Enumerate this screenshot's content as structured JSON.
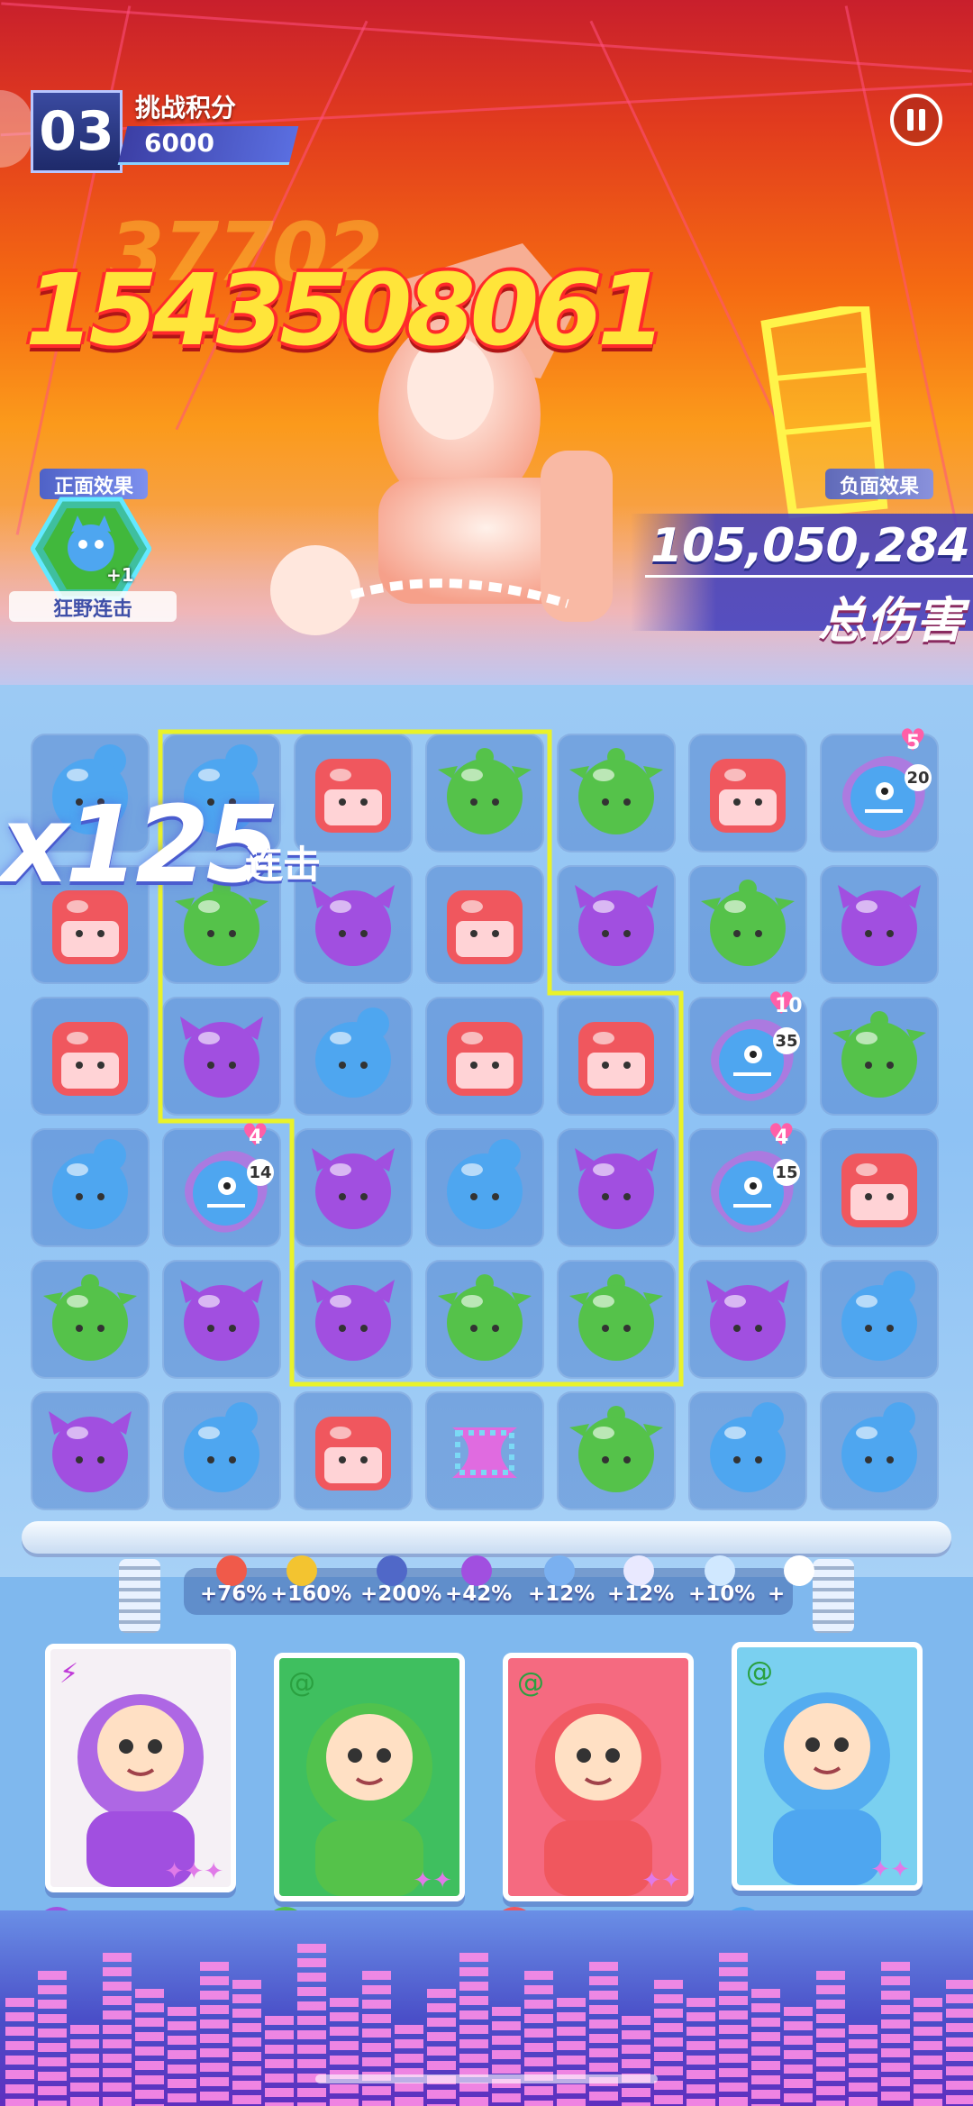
{
  "hud": {
    "stage_number": "03",
    "score_label": "挑战积分",
    "score_value": "6000",
    "pause_icon": "pause-icon"
  },
  "battle": {
    "damage_popup_ghost": "37702",
    "damage_popup": "1543508061",
    "positive_effect_label": "正面效果",
    "positive_effect_stack": "+1",
    "positive_effect_name": "狂野连击",
    "negative_effect_label": "负面效果",
    "total_damage_value": "105,050,284",
    "total_damage_label": "总伤害"
  },
  "board": {
    "combo_value": "x125",
    "combo_label": "连击",
    "colors": {
      "blue": "#4ea6f0",
      "red": "#f0575e",
      "green": "#55c24a",
      "purple": "#a14fe0"
    },
    "rows": [
      [
        "blue",
        "blue",
        "red",
        "green",
        "green",
        "red",
        "shark"
      ],
      [
        "red",
        "green",
        "purple",
        "red",
        "purple",
        "green",
        "purple"
      ],
      [
        "red",
        "purple",
        "blue",
        "red",
        "red",
        "shark",
        "green"
      ],
      [
        "blue",
        "shark",
        "purple",
        "blue",
        "purple",
        "shark",
        "red"
      ],
      [
        "green",
        "purple",
        "purple",
        "green",
        "green",
        "purple",
        "blue"
      ],
      [
        "purple",
        "blue",
        "red",
        "special",
        "green",
        "blue",
        "blue"
      ]
    ],
    "shark_badges": [
      {
        "row": 0,
        "col": 6,
        "hearts": "5",
        "turns": "20"
      },
      {
        "row": 2,
        "col": 5,
        "hearts": "10",
        "turns": "35"
      },
      {
        "row": 3,
        "col": 1,
        "hearts": "4",
        "turns": "14"
      },
      {
        "row": 3,
        "col": 5,
        "hearts": "4",
        "turns": "15"
      }
    ]
  },
  "buffs": [
    "+76%",
    "+160%",
    "+200%",
    "+42%",
    "+12%",
    "+12%",
    "+10%",
    "+"
  ],
  "heroes": [
    {
      "name": "skull-helmet-warrior",
      "color": "#a14fe0",
      "bar": "#d25fd8",
      "filled": 6,
      "stars": "✦✦✦"
    },
    {
      "name": "opera-warrior",
      "color": "#55c24a",
      "bar": "#5ad14a",
      "filled": 6,
      "stars": "✦✦"
    },
    {
      "name": "astronaut-bear",
      "color": "#f0575e",
      "bar": "#f3d523",
      "filled": 6,
      "stars": "✦✦"
    },
    {
      "name": "pink-girl",
      "color": "#4ea6f0",
      "bar": "#3fd9e8",
      "filled": 6,
      "stars": "✦✦"
    }
  ]
}
